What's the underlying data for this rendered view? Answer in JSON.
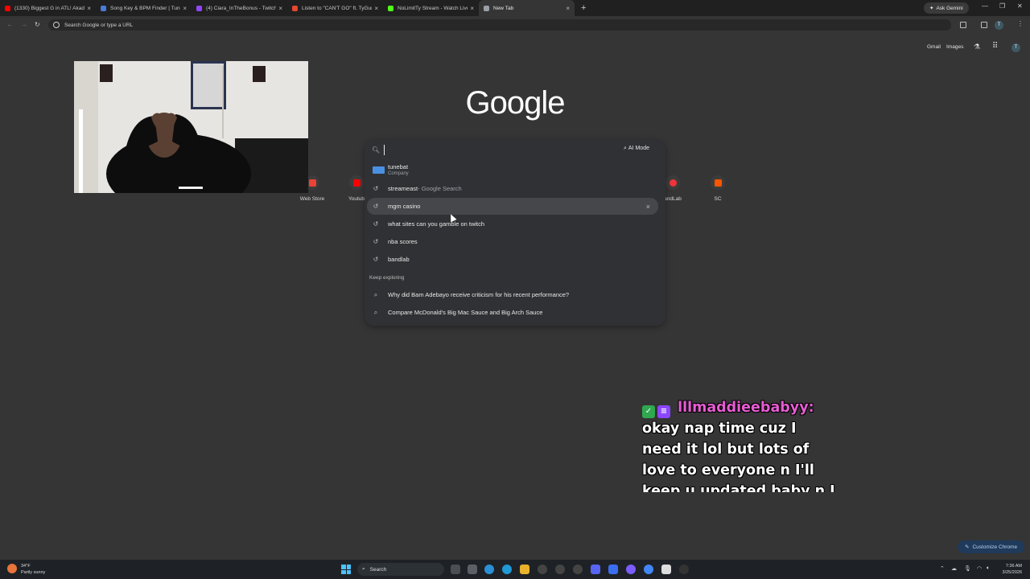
{
  "tabs": [
    {
      "title": "(1330) Biggest G in ATL! Akade",
      "color": "#ff0000"
    },
    {
      "title": "Song Key & BPM Finder | Tune",
      "color": "#4a7bd6"
    },
    {
      "title": "(4) Ciara_InTheBonus - Twitch",
      "color": "#9146ff"
    },
    {
      "title": "Listen to \"CAN'T GO\" ft. TyGun",
      "color": "#e8462e"
    },
    {
      "title": "NoLimitTy Stream - Watch Live",
      "color": "#53fc18"
    },
    {
      "title": "New Tab",
      "color": "#9aa0a6"
    }
  ],
  "new_tab_glyph": "+",
  "ask_gemini": "Ask Gemini",
  "omnibox_placeholder": "Search Google or type a URL",
  "header_links": {
    "gmail": "Gmail",
    "images": "Images"
  },
  "profile_initial": "T",
  "logo_text": "Google",
  "search": {
    "ai_mode": "AI Mode",
    "suggestions": [
      {
        "text": "tunebat",
        "sub": "Company",
        "icon": "tunebat-favicon"
      },
      {
        "text": "streameast",
        "suffix": " - Google Search",
        "icon": "history-icon"
      },
      {
        "text": "mgm casino",
        "icon": "history-icon",
        "highlighted": true,
        "remove": "×"
      },
      {
        "text": "what sites can you gamble on twitch",
        "icon": "history-icon"
      },
      {
        "text": "nba scores",
        "icon": "history-icon"
      },
      {
        "text": "bandlab",
        "icon": "history-icon"
      }
    ],
    "keep_exploring_label": "Keep exploring",
    "explore": [
      {
        "text": "Why did Bam Adebayo receive criticism for his recent performance?"
      },
      {
        "text": "Compare McDonald's Big Mac Sauce and Big Arch Sauce"
      }
    ]
  },
  "shortcuts": [
    {
      "label": "Web Store",
      "color": "#ea4335"
    },
    {
      "label": "Youtub",
      "color": "#ff0000"
    },
    {
      "label": "andLab",
      "color": "#f2333a"
    },
    {
      "label": "SC",
      "color": "#ff5500"
    }
  ],
  "chat": {
    "username": "lllmaddieebabyy:",
    "message": "okay nap time cuz I need it lol but lots of love to everyone n I'll keep u updated baby n I love you",
    "badges": [
      {
        "color": "#2fa84f"
      },
      {
        "color": "#8b46ff"
      }
    ]
  },
  "customize_chrome": "Customize Chrome",
  "taskbar": {
    "weather_temp": "34°F",
    "weather_desc": "Partly sunny",
    "search_label": "Search",
    "time": "7:36 AM",
    "date": "3/25/2026"
  },
  "colors": {
    "background": "#353535",
    "dropdown": "#303134",
    "chat_user": "#e85cd4"
  }
}
